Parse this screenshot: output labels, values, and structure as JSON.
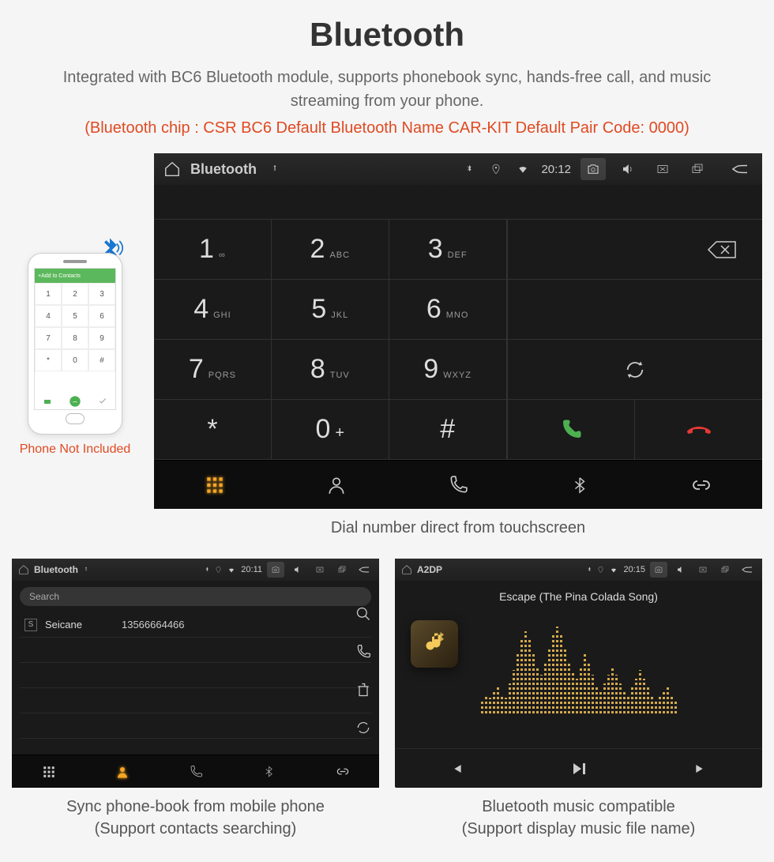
{
  "header": {
    "title": "Bluetooth",
    "subtitle": "Integrated with BC6 Bluetooth module, supports phonebook sync, hands-free call, and music streaming from your phone.",
    "specs": "(Bluetooth chip : CSR BC6    Default Bluetooth Name CAR-KIT    Default Pair Code: 0000)"
  },
  "phone_mock": {
    "header": "Add to Contacts",
    "caption": "Phone Not Included",
    "keys": [
      "1",
      "2",
      "3",
      "4",
      "5",
      "6",
      "7",
      "8",
      "9",
      "*",
      "0",
      "#"
    ]
  },
  "main_screen": {
    "app": "Bluetooth",
    "time": "20:12",
    "keys": [
      {
        "num": "1",
        "sub": "∞"
      },
      {
        "num": "2",
        "sub": "ABC"
      },
      {
        "num": "3",
        "sub": "DEF"
      },
      {
        "num": "4",
        "sub": "GHI"
      },
      {
        "num": "5",
        "sub": "JKL"
      },
      {
        "num": "6",
        "sub": "MNO"
      },
      {
        "num": "7",
        "sub": "PQRS"
      },
      {
        "num": "8",
        "sub": "TUV"
      },
      {
        "num": "9",
        "sub": "WXYZ"
      },
      {
        "num": "*",
        "sub": ""
      },
      {
        "num": "0",
        "sub": "",
        "plus": "+"
      },
      {
        "num": "#",
        "sub": ""
      }
    ],
    "caption": "Dial number direct from touchscreen"
  },
  "phonebook_screen": {
    "app": "Bluetooth",
    "time": "20:11",
    "search_placeholder": "Search",
    "contact": {
      "badge": "S",
      "name": "Seicane",
      "number": "13566664466"
    },
    "caption_l1": "Sync phone-book from mobile phone",
    "caption_l2": "(Support contacts searching)"
  },
  "music_screen": {
    "app": "A2DP",
    "time": "20:15",
    "song": "Escape (The Pina Colada Song)",
    "caption_l1": "Bluetooth music compatible",
    "caption_l2": "(Support display music file name)"
  }
}
